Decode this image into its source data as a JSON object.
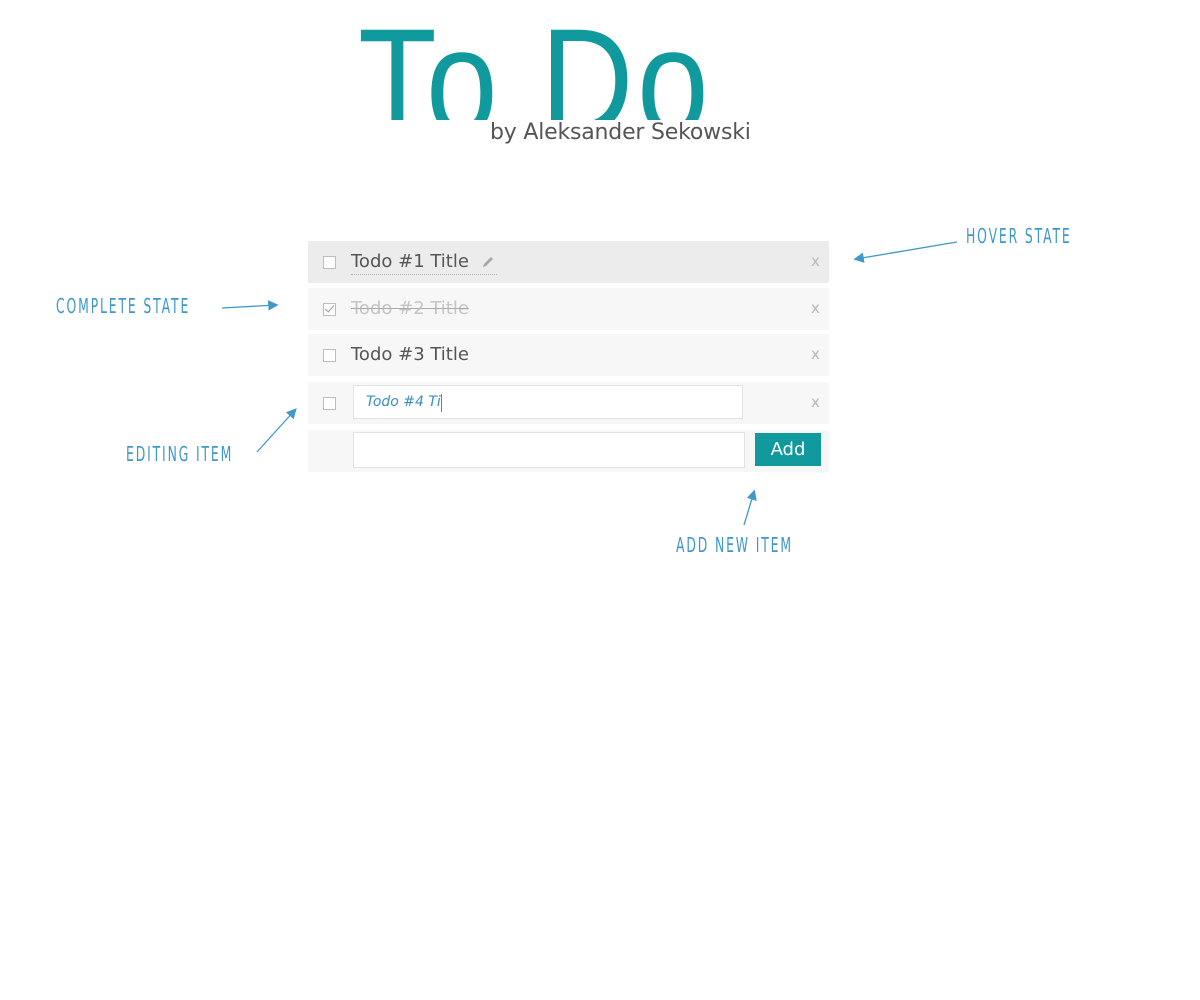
{
  "header": {
    "title": "To Do",
    "byline": "by Aleksander Sekowski"
  },
  "todos": [
    {
      "title": "Todo #1 Title",
      "state": "hover",
      "completed": false,
      "remove_label": "x"
    },
    {
      "title": "Todo #2 Title",
      "state": "complete",
      "completed": true,
      "remove_label": "x"
    },
    {
      "title": "Todo #3 Title",
      "state": "normal",
      "completed": false,
      "remove_label": "x"
    },
    {
      "title": "Todo #4 Ti",
      "state": "editing",
      "completed": false,
      "remove_label": "x"
    }
  ],
  "new_item": {
    "value": "",
    "add_label": "Add"
  },
  "annotations": {
    "hover": "HOVER STATE",
    "complete": "COMPLETE STATE",
    "editing": "EDITING ITEM",
    "add_new": "ADD NEW ITEM"
  },
  "colors": {
    "accent": "#109a9e",
    "annotation": "#3f98c9",
    "row_bg": "#f7f7f7",
    "row_hover_bg": "#ececec"
  }
}
